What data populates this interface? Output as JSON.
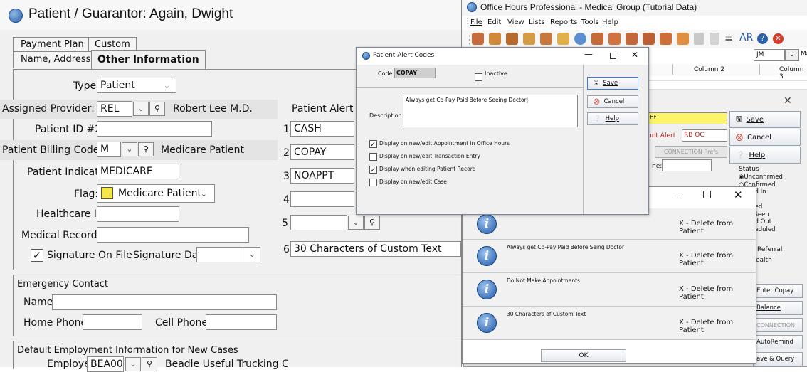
{
  "left_window": {
    "title": "Patient / Guarantor: Again, Dwight",
    "tabs_row1": [
      "Payment Plan",
      "Custom"
    ],
    "tabs_row2": [
      "Name, Address",
      "Other Information"
    ],
    "type_label": "Type:",
    "type_value": "Patient",
    "assigned_provider_label": "Assigned Provider:",
    "assigned_provider_value": "REL",
    "assigned_provider_name": "Robert Lee M.D.",
    "patient_id2_label": "Patient ID #2:",
    "patient_id2_value": "",
    "billing_code_label": "Patient Billing Code:",
    "billing_code_value": "M",
    "billing_code_name": "Medicare Patient",
    "indicator_label": "Patient Indicator:",
    "indicator_value": "MEDICARE",
    "flag_label": "Flag:",
    "flag_value": "Medicare Patient",
    "flag_color": "#f6e64a",
    "healthcare_id_label": "Healthcare ID:",
    "healthcare_id_value": "",
    "medical_record_label": "Medical Record #:",
    "medical_record_value": "",
    "signature_label": "Signature On File",
    "signature_checked": true,
    "signature_date_label": "Signature Date:",
    "signature_date_value": "",
    "alert_codes_label": "Patient Alert Cod",
    "alert_codes": [
      {
        "n": "1",
        "code": "CASH"
      },
      {
        "n": "2",
        "code": "COPAY"
      },
      {
        "n": "3",
        "code": "NOAPPT"
      },
      {
        "n": "4",
        "code": ""
      },
      {
        "n": "5",
        "code": ""
      }
    ],
    "alert_custom_n": "6",
    "alert_custom_text": "30 Characters of Custom Text",
    "emergency_title": "Emergency Contact",
    "emergency_name_label": "Name:",
    "home_phone_label": "Home Phone:",
    "cell_phone_label": "Cell Phone:",
    "employment_title": "Default Employment Information for New Cases",
    "employer_label": "Employer:",
    "employer_value": "BEA00",
    "employer_name": "Beadle Useful Trucking C"
  },
  "right_app": {
    "title": "Office Hours Professional - Medical Group (Tutorial Data)",
    "menu": [
      "File",
      "Edit",
      "View",
      "Lists",
      "Reports",
      "Tools",
      "Help"
    ],
    "toolbar_right_combo": "JM",
    "toolbar_right_text": "Mai",
    "column_headers": [
      "Column 2",
      "Column 3"
    ],
    "toolbar_ar": "AR"
  },
  "alert_dialog": {
    "title": "Patient Alert Codes",
    "code_label": "Code:",
    "code_value": "COPAY",
    "inactive_label": "Inactive",
    "description_label": "Description:",
    "description_value": "Always get Co-Pay Paid Before Seeing Doctor",
    "options": [
      {
        "label": "Display on new/edit Appointment in Office Hours",
        "checked": true
      },
      {
        "label": "Display on new/edit Transaction Entry",
        "checked": false
      },
      {
        "label": "Display when editing Patient Record",
        "checked": true
      },
      {
        "label": "Display on new/edit Case",
        "checked": false
      }
    ],
    "buttons": [
      "Save",
      "Cancel",
      "Help"
    ]
  },
  "appt_dialog": {
    "save": "Save",
    "cancel": "Cancel",
    "help": "Help",
    "partial_ht": "ht",
    "alert_label": "unt Alert",
    "alert_value": "RB OC",
    "connection_label": "CONNECTION Prefs",
    "ne_label": "ne:",
    "status_title": "Status",
    "status_items": [
      "Unconfirmed",
      "Confirmed",
      "cked In",
      "sed",
      "celled",
      "ng Seen",
      "cked Out",
      "scheduled"
    ],
    "referral": "Referral",
    "health": "ealth",
    "enter_copay": "Enter Copay",
    "balance": "Balance",
    "connection": "CONNECTION",
    "autoremind": "AutoRemind",
    "save_query": "ave & Query"
  },
  "alerts_popup": {
    "items": [
      {
        "text": "",
        "action": "X - Delete from Patient"
      },
      {
        "text": "Always get Co-Pay Paid Before Seing Doctor",
        "action": "X - Delete from Patient"
      },
      {
        "text": "Do Not Make Appointments",
        "action": "X - Delete from Patient"
      },
      {
        "text": "30 Characters of Custom Text",
        "action": "X - Delete from Patient"
      }
    ],
    "ok_label": "OK"
  }
}
